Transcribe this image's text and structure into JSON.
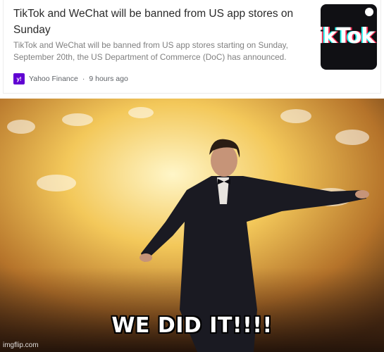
{
  "news_card": {
    "headline": "TikTok and WeChat will be banned from US app stores on Sunday",
    "summary": "TikTok and WeChat will be banned from US app stores starting on Sunday, September 20th, the US Department of Commerce (DoC) has announced.",
    "source_name": "Yahoo Finance",
    "separator": "·",
    "time_ago": "9 hours ago",
    "source_logo_letter": "y!",
    "thumbnail_text": "ikTok",
    "colors": {
      "yahoo_purple": "#6001d2"
    }
  },
  "meme": {
    "caption": "WE DID IT!!!!",
    "watermark": "imgflip.com"
  }
}
